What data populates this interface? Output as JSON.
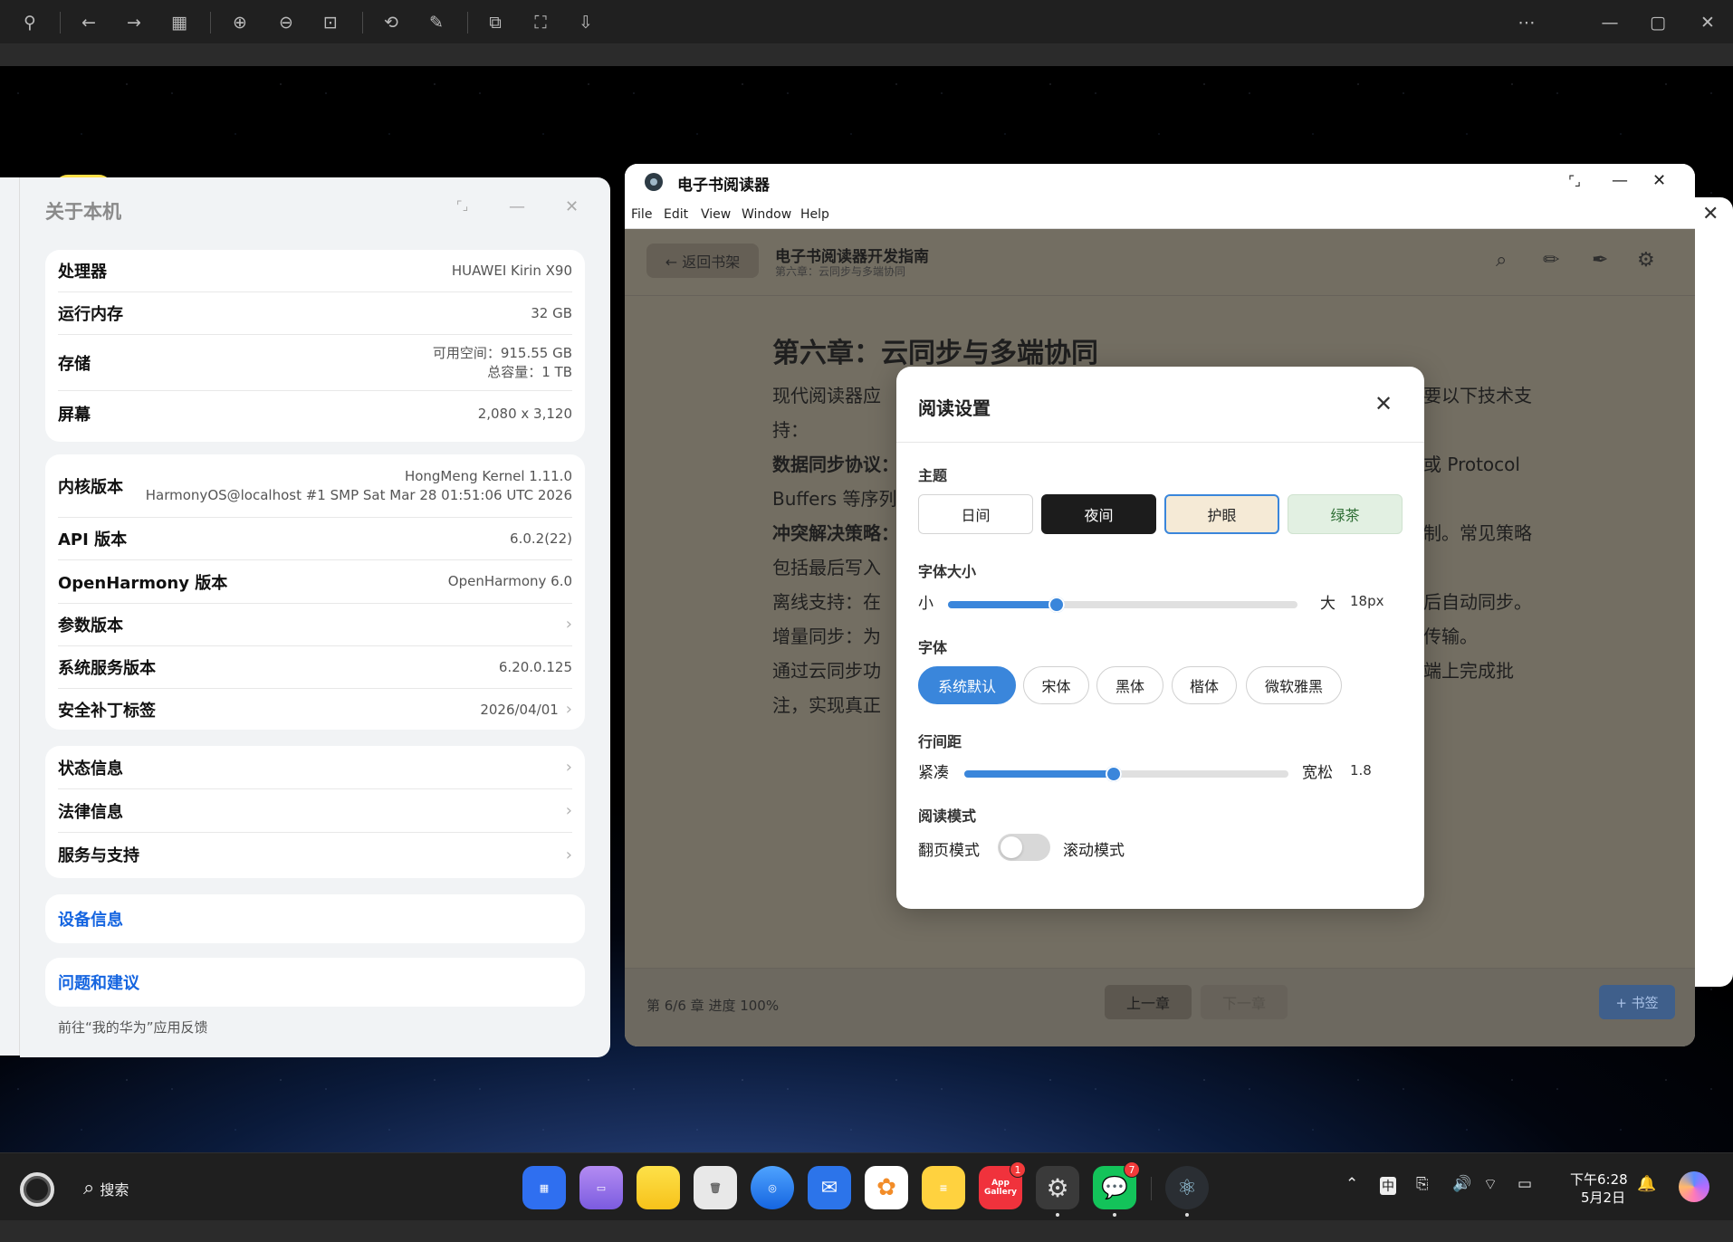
{
  "desktop": {
    "reader": {
      "app_title": "电子书阅读器",
      "menu": [
        "File",
        "Edit",
        "View",
        "Window",
        "Help"
      ],
      "back_label": "← 返回书架",
      "book_title": "电子书阅读器开发指南",
      "chapter_sub": "第六章：云同步与多端协同",
      "chapter_heading": "第六章：云同步与多端协同",
      "paragraph_left": [
        "现代阅读器应",
        "持：",
        "数据同步协议：",
        "Buffers 等序列",
        "冲突解决策略：",
        "包括最后写入",
        "离线支持：在",
        "增量同步：为",
        "通过云同步功",
        "注，实现真正"
      ],
      "paragraph_right": [
        "要以下技术支",
        "或 Protocol",
        "制。常见策略",
        "后自动同步。",
        "传输。",
        "端上完成批"
      ],
      "footer": {
        "progress": "第 6/6 章   进度 100%",
        "prev": "上一章",
        "next": "下一章",
        "bookmark": "+ 书签"
      },
      "settings": {
        "title": "阅读设置",
        "theme_label": "主题",
        "themes": [
          "日间",
          "夜间",
          "护眼",
          "绿茶"
        ],
        "selected_theme": "护眼",
        "font_size_label": "字体大小",
        "font_size_min": "小",
        "font_size_max": "大",
        "font_size_value": "18px",
        "font_size_fraction": 0.31,
        "font_label": "字体",
        "fonts": [
          "系统默认",
          "宋体",
          "黑体",
          "楷体",
          "微软雅黑"
        ],
        "selected_font": "系统默认",
        "line_height_label": "行间距",
        "line_height_min": "紧凑",
        "line_height_max": "宽松",
        "line_height_value": "1.8",
        "line_height_fraction": 0.46,
        "mode_label": "阅读模式",
        "mode_left": "翻页模式",
        "mode_right": "滚动模式",
        "scroll_mode_on": false
      }
    },
    "about": {
      "title": "关于本机",
      "card1": [
        {
          "k": "处理器",
          "v": "HUAWEI Kirin X90"
        },
        {
          "k": "运行内存",
          "v": "32 GB"
        },
        {
          "k": "存储",
          "v1": "可用空间：915.55 GB",
          "v2": "总容量：1 TB"
        },
        {
          "k": "屏幕",
          "v": "2,080 x 3,120"
        }
      ],
      "card2": [
        {
          "k": "内核版本",
          "v1": "HongMeng Kernel 1.11.0",
          "v2": "HarmonyOS@localhost #1 SMP Sat Mar 28 01:51:06 UTC 2026"
        },
        {
          "k": "API 版本",
          "v": "6.0.2(22)"
        },
        {
          "k": "OpenHarmony 版本",
          "v": "OpenHarmony 6.0"
        },
        {
          "k": "参数版本",
          "v": ""
        },
        {
          "k": "系统服务版本",
          "v": "6.20.0.125"
        },
        {
          "k": "安全补丁标签",
          "v": "2026/04/01"
        }
      ],
      "card3": [
        "状态信息",
        "法律信息",
        "服务与支持"
      ],
      "device_info": "设备信息",
      "feedback": "问题和建议",
      "feedback_hint": "前往“我的华为”应用反馈"
    }
  },
  "taskbar": {
    "search": "搜索",
    "apps": [
      {
        "name": "launcher",
        "label": ""
      },
      {
        "name": "multitask",
        "label": ""
      },
      {
        "name": "files",
        "label": ""
      },
      {
        "name": "recycle-bin",
        "label": ""
      },
      {
        "name": "browser",
        "label": ""
      },
      {
        "name": "mail",
        "label": ""
      },
      {
        "name": "gallery",
        "label": ""
      },
      {
        "name": "notes",
        "label": ""
      },
      {
        "name": "app-gallery",
        "label": "App Gallery",
        "badge": "1"
      },
      {
        "name": "settings",
        "label": ""
      },
      {
        "name": "wechat",
        "label": "",
        "badge": "7"
      },
      {
        "name": "electron",
        "label": ""
      }
    ],
    "ime": "中",
    "time": "下午6:28",
    "date": "5月2日"
  }
}
